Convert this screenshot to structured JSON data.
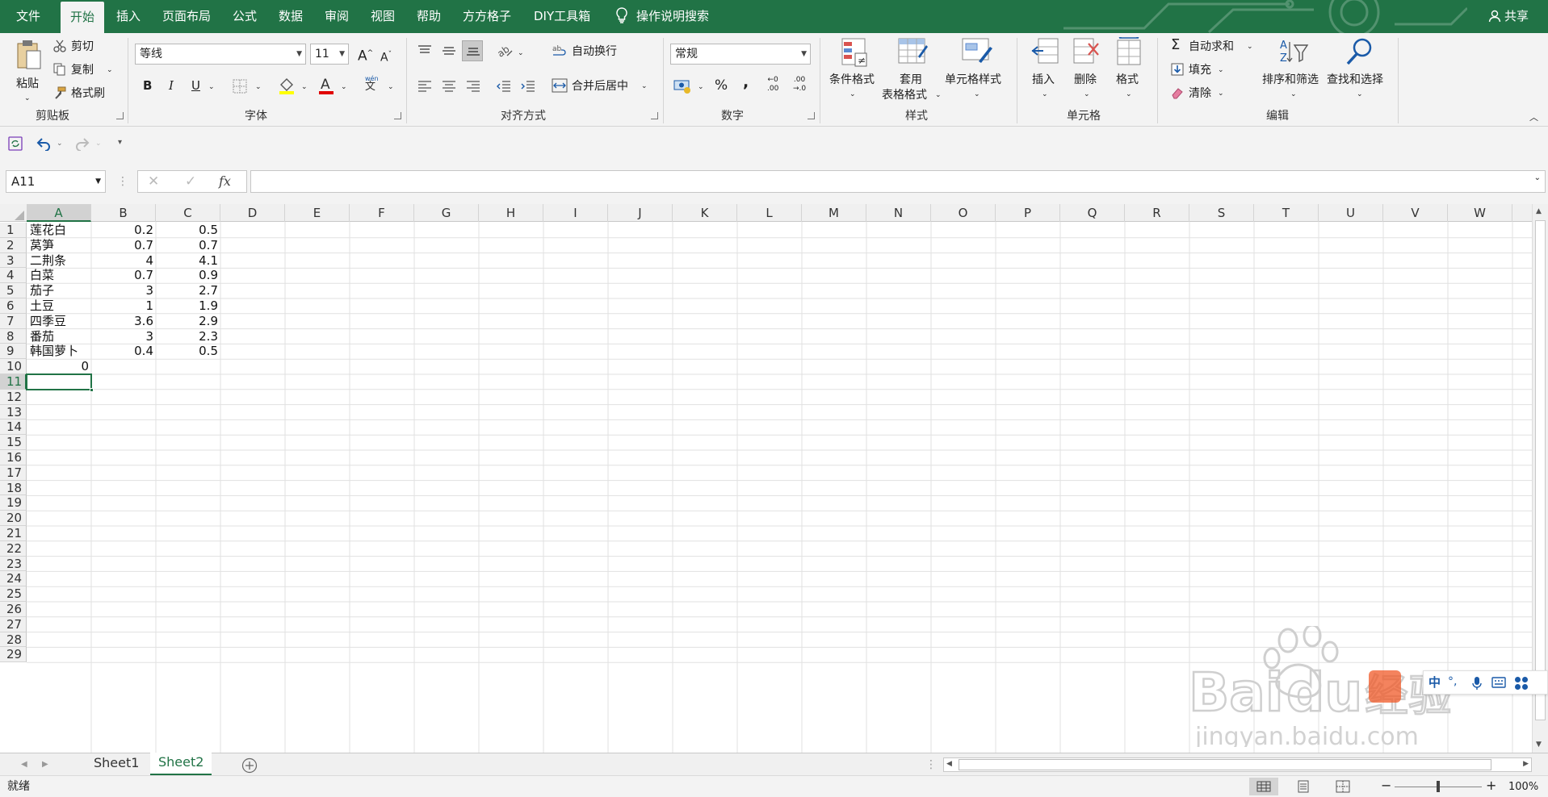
{
  "tabs": {
    "file": "文件",
    "home": "开始",
    "insert": "插入",
    "page_layout": "页面布局",
    "formulas": "公式",
    "data": "数据",
    "review": "审阅",
    "view": "视图",
    "help": "帮助",
    "ffgz": "方方格子",
    "diy": "DIY工具箱",
    "tell_me": "操作说明搜索",
    "share": "共享"
  },
  "ribbon": {
    "clipboard": {
      "paste": "粘贴",
      "cut": "剪切",
      "copy": "复制",
      "format_painter": "格式刷",
      "label": "剪贴板"
    },
    "font": {
      "name": "等线",
      "size": "11",
      "bold": "B",
      "italic": "I",
      "underline": "U",
      "grow": "A",
      "shrink": "A",
      "phonetic_top": "wén",
      "phonetic_bottom": "文",
      "label": "字体"
    },
    "alignment": {
      "wrap": "自动换行",
      "merge": "合并后居中",
      "label": "对齐方式"
    },
    "number": {
      "format": "常规",
      "percent": "%",
      "comma": ",",
      "inc_dec_top": "←0",
      "inc_dec_bottom": ".00",
      "dec_dec_top": ".00",
      "dec_dec_bottom": "→.0",
      "label": "数字"
    },
    "styles": {
      "conditional": "条件格式",
      "table_top": "套用",
      "table_bottom": "表格格式",
      "cell_styles": "单元格样式",
      "label": "样式"
    },
    "cells": {
      "insert": "插入",
      "delete": "删除",
      "format": "格式",
      "label": "单元格"
    },
    "editing": {
      "autosum": "自动求和",
      "fill": "填充",
      "clear": "清除",
      "sort": "排序和筛选",
      "find": "查找和选择",
      "label": "编辑"
    }
  },
  "name_box": "A11",
  "fx": "fx",
  "columns": [
    "A",
    "B",
    "C",
    "D",
    "E",
    "F",
    "G",
    "H",
    "I",
    "J",
    "K",
    "L",
    "M",
    "N",
    "O",
    "P",
    "Q",
    "R",
    "S",
    "T",
    "U",
    "V",
    "W"
  ],
  "selected_column": "A",
  "rows": [
    "1",
    "2",
    "3",
    "4",
    "5",
    "6",
    "7",
    "8",
    "9",
    "10",
    "11",
    "12",
    "13",
    "14",
    "15",
    "16",
    "17",
    "18",
    "19",
    "20",
    "21",
    "22",
    "23",
    "24",
    "25",
    "26",
    "27",
    "28",
    "29"
  ],
  "selected_row": "11",
  "cells": [
    {
      "a": "莲花白",
      "b": "0.2",
      "c": "0.5"
    },
    {
      "a": "莴笋",
      "b": "0.7",
      "c": "0.7"
    },
    {
      "a": "二荆条",
      "b": "4",
      "c": "4.1"
    },
    {
      "a": "白菜",
      "b": "0.7",
      "c": "0.9"
    },
    {
      "a": "茄子",
      "b": "3",
      "c": "2.7"
    },
    {
      "a": "土豆",
      "b": "1",
      "c": "1.9"
    },
    {
      "a": "四季豆",
      "b": "3.6",
      "c": "2.9"
    },
    {
      "a": "番茄",
      "b": "3",
      "c": "2.3"
    },
    {
      "a": "韩国萝卜",
      "b": "0.4",
      "c": "0.5"
    },
    {
      "a": "0",
      "b": "",
      "c": ""
    }
  ],
  "sheets": [
    "Sheet1",
    "Sheet2"
  ],
  "active_sheet": "Sheet2",
  "status": {
    "ready": "就绪",
    "zoom": "100%",
    "minus": "−",
    "plus": "+"
  },
  "watermark": {
    "brand": "Bai",
    "brand2": "du",
    "cn": "经验",
    "url": "jingyan.baidu.com"
  },
  "ime": {
    "lang": "中",
    "punct": "°,"
  },
  "colors": {
    "excel_green": "#217346",
    "grid_line": "#d4d4d4",
    "header_bg": "#f0f0f0"
  }
}
